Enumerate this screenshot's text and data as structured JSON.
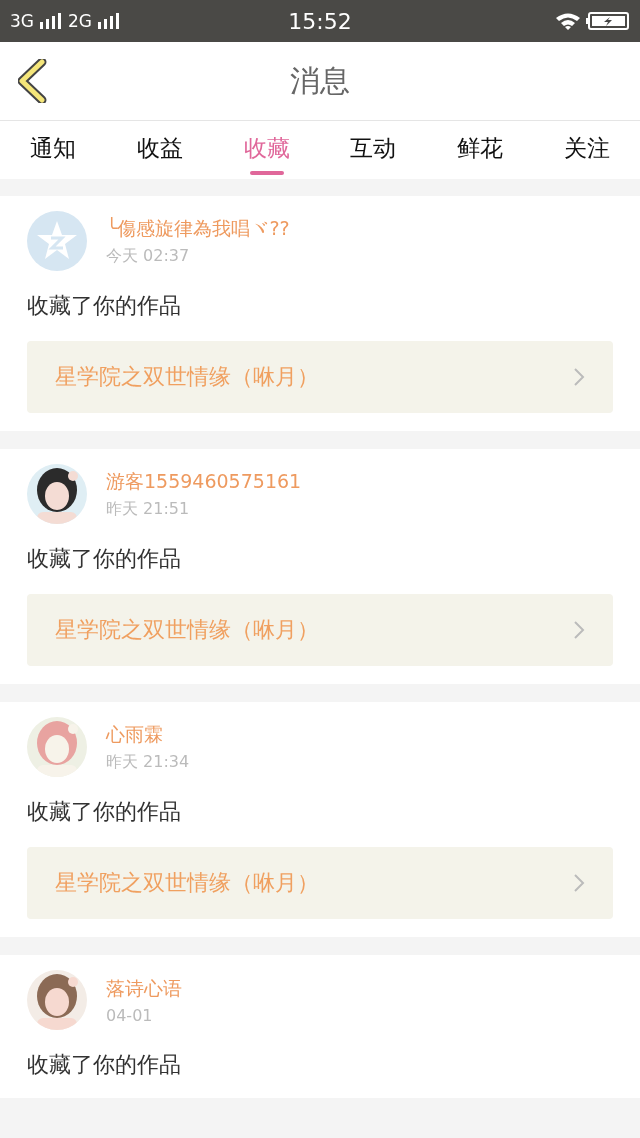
{
  "status_bar": {
    "network_1": "3G",
    "network_2": "2G",
    "time": "15:52"
  },
  "header": {
    "title": "消息"
  },
  "tabs": [
    {
      "label": "通知",
      "selected": false
    },
    {
      "label": "收益",
      "selected": false
    },
    {
      "label": "收藏",
      "selected": true
    },
    {
      "label": "互动",
      "selected": false
    },
    {
      "label": "鲜花",
      "selected": false
    },
    {
      "label": "关注",
      "selected": false
    }
  ],
  "messages": [
    {
      "avatar": {
        "kind": "default"
      },
      "user": "╰傷感旋律為我唱ヾ??",
      "time": "今天 02:37",
      "text": "收藏了你的作品",
      "work": "星学院之双世情缘（咻月）"
    },
    {
      "user": "游客1559460575161",
      "time": "昨天 21:51",
      "text": "收藏了你的作品",
      "work": "星学院之双世情缘（咻月）"
    },
    {
      "user": "心雨霖",
      "time": "昨天 21:34",
      "text": "收藏了你的作品",
      "work": "星学院之双世情缘（咻月）"
    },
    {
      "user": "落诗心语",
      "time": "04-01",
      "text": "收藏了你的作品"
    }
  ]
}
